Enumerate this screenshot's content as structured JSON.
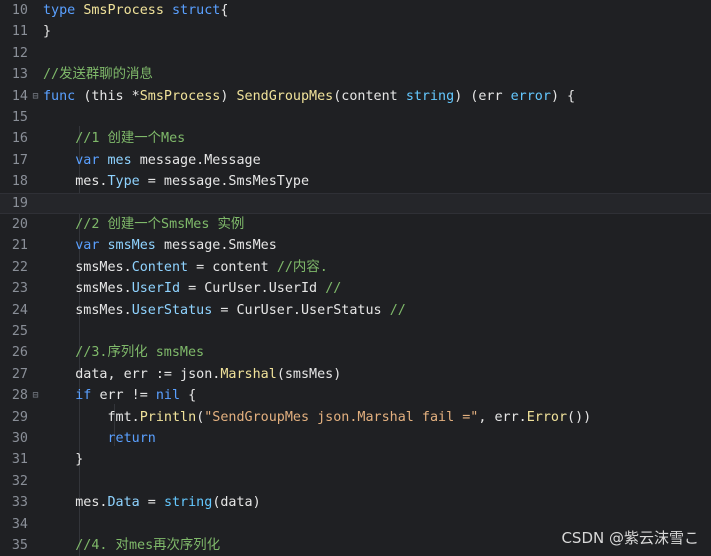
{
  "lines": [
    {
      "n": "10",
      "fold": "",
      "parts": [
        [
          "kw",
          "type "
        ],
        [
          "fn",
          "SmsProcess "
        ],
        [
          "kw",
          "struct"
        ],
        [
          "",
          "{"
        ]
      ]
    },
    {
      "n": "11",
      "fold": "",
      "parts": [
        [
          "",
          "}"
        ]
      ]
    },
    {
      "n": "12",
      "fold": "",
      "parts": []
    },
    {
      "n": "13",
      "fold": "",
      "parts": [
        [
          "cm",
          "//发送群聊的消息"
        ]
      ]
    },
    {
      "n": "14",
      "fold": "⊟",
      "parts": [
        [
          "kw",
          "func "
        ],
        [
          "",
          "(this *"
        ],
        [
          "fn",
          "SmsProcess"
        ],
        [
          "",
          ") "
        ],
        [
          "fn",
          "SendGroupMes"
        ],
        [
          "",
          "(content "
        ],
        [
          "ty",
          "string"
        ],
        [
          "",
          ") (err "
        ],
        [
          "ty",
          "error"
        ],
        [
          "",
          ") {"
        ]
      ]
    },
    {
      "n": "15",
      "fold": "",
      "parts": []
    },
    {
      "n": "16",
      "fold": "",
      "parts": [
        [
          "",
          "    "
        ],
        [
          "cm",
          "//1 创建一个Mes"
        ]
      ]
    },
    {
      "n": "17",
      "fold": "",
      "parts": [
        [
          "",
          "    "
        ],
        [
          "kw",
          "var "
        ],
        [
          "fld",
          "mes "
        ],
        [
          "",
          "message.Message"
        ]
      ]
    },
    {
      "n": "18",
      "fold": "",
      "parts": [
        [
          "",
          "    mes."
        ],
        [
          "fld",
          "Type"
        ],
        [
          "",
          " = message.SmsMesType"
        ]
      ]
    },
    {
      "n": "19",
      "fold": "",
      "parts": [],
      "current": true
    },
    {
      "n": "20",
      "fold": "",
      "parts": [
        [
          "",
          "    "
        ],
        [
          "cm",
          "//2 创建一个SmsMes 实例"
        ]
      ]
    },
    {
      "n": "21",
      "fold": "",
      "parts": [
        [
          "",
          "    "
        ],
        [
          "kw",
          "var "
        ],
        [
          "fld",
          "smsMes "
        ],
        [
          "",
          "message.SmsMes"
        ]
      ]
    },
    {
      "n": "22",
      "fold": "",
      "parts": [
        [
          "",
          "    smsMes."
        ],
        [
          "fld",
          "Content"
        ],
        [
          "",
          " = content "
        ],
        [
          "cm",
          "//内容."
        ]
      ]
    },
    {
      "n": "23",
      "fold": "",
      "parts": [
        [
          "",
          "    smsMes."
        ],
        [
          "fld",
          "UserId"
        ],
        [
          "",
          " = CurUser.UserId "
        ],
        [
          "cm",
          "//"
        ]
      ]
    },
    {
      "n": "24",
      "fold": "",
      "parts": [
        [
          "",
          "    smsMes."
        ],
        [
          "fld",
          "UserStatus"
        ],
        [
          "",
          " = CurUser.UserStatus "
        ],
        [
          "cm",
          "//"
        ]
      ]
    },
    {
      "n": "25",
      "fold": "",
      "parts": []
    },
    {
      "n": "26",
      "fold": "",
      "parts": [
        [
          "",
          "    "
        ],
        [
          "cm",
          "//3.序列化 smsMes"
        ]
      ]
    },
    {
      "n": "27",
      "fold": "",
      "parts": [
        [
          "",
          "    data, err := json."
        ],
        [
          "fn",
          "Marshal"
        ],
        [
          "",
          "(smsMes)"
        ]
      ]
    },
    {
      "n": "28",
      "fold": "⊟",
      "parts": [
        [
          "",
          "    "
        ],
        [
          "kw",
          "if "
        ],
        [
          "",
          "err != "
        ],
        [
          "kw",
          "nil"
        ],
        [
          "",
          " {"
        ]
      ]
    },
    {
      "n": "29",
      "fold": "",
      "parts": [
        [
          "",
          "        fmt."
        ],
        [
          "fn",
          "Println"
        ],
        [
          "",
          "("
        ],
        [
          "st",
          "\"SendGroupMes json.Marshal fail =\""
        ],
        [
          "",
          ", err."
        ],
        [
          "fn",
          "Error"
        ],
        [
          "",
          "())"
        ]
      ]
    },
    {
      "n": "30",
      "fold": "",
      "parts": [
        [
          "",
          "        "
        ],
        [
          "kw",
          "return"
        ]
      ]
    },
    {
      "n": "31",
      "fold": "",
      "parts": [
        [
          "",
          "    }"
        ]
      ]
    },
    {
      "n": "32",
      "fold": "",
      "parts": []
    },
    {
      "n": "33",
      "fold": "",
      "parts": [
        [
          "",
          "    mes."
        ],
        [
          "fld",
          "Data"
        ],
        [
          "",
          " = "
        ],
        [
          "ty",
          "string"
        ],
        [
          "",
          "(data)"
        ]
      ]
    },
    {
      "n": "34",
      "fold": "",
      "parts": []
    },
    {
      "n": "35",
      "fold": "",
      "parts": [
        [
          "",
          "    "
        ],
        [
          "cm",
          "//4. 对mes再次序列化"
        ]
      ]
    }
  ],
  "watermark": "CSDN @紫云沫雪こ"
}
